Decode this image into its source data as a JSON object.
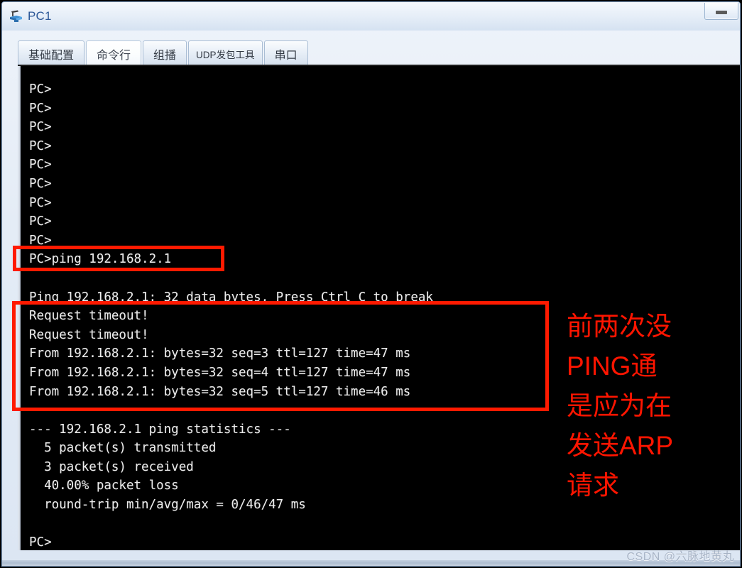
{
  "window": {
    "title": "PC1",
    "icon": "pc-device-icon",
    "minimize_label": "—",
    "accent_color": "#2b5797"
  },
  "tabs": [
    {
      "label": "基础配置",
      "name": "tab-basic-config",
      "active": false,
      "small": false
    },
    {
      "label": "命令行",
      "name": "tab-command-line",
      "active": true,
      "small": false
    },
    {
      "label": "组播",
      "name": "tab-multicast",
      "active": false,
      "small": false
    },
    {
      "label": "UDP发包工具",
      "name": "tab-udp-tool",
      "active": false,
      "small": true
    },
    {
      "label": "串口",
      "name": "tab-serial-port",
      "active": false,
      "small": false
    }
  ],
  "terminal": {
    "prompt": "PC>",
    "lines": [
      "PC>",
      "PC>",
      "PC>",
      "PC>",
      "PC>",
      "PC>",
      "PC>",
      "PC>",
      "PC>",
      "PC>ping 192.168.2.1",
      "",
      "Ping 192.168.2.1: 32 data bytes, Press Ctrl C to break",
      "Request timeout!",
      "Request timeout!",
      "From 192.168.2.1: bytes=32 seq=3 ttl=127 time=47 ms",
      "From 192.168.2.1: bytes=32 seq=4 ttl=127 time=47 ms",
      "From 192.168.2.1: bytes=32 seq=5 ttl=127 time=46 ms",
      "",
      "--- 192.168.2.1 ping statistics ---",
      "  5 packet(s) transmitted",
      "  3 packet(s) received",
      "  40.00% packet loss",
      "  round-trip min/avg/max = 0/46/47 ms",
      "",
      "PC>"
    ],
    "command": "ping 192.168.2.1",
    "target_ip": "192.168.2.1",
    "ping_summary": {
      "data_bytes": 32,
      "transmitted": 5,
      "received": 3,
      "packet_loss": "40.00%",
      "rtt_min_ms": 0,
      "rtt_avg_ms": 46,
      "rtt_max_ms": 47,
      "timeouts": 2,
      "replies": [
        {
          "seq": 3,
          "bytes": 32,
          "ttl": 127,
          "time_ms": 47
        },
        {
          "seq": 4,
          "bytes": 32,
          "ttl": 127,
          "time_ms": 47
        },
        {
          "seq": 5,
          "bytes": 32,
          "ttl": 127,
          "time_ms": 46
        }
      ]
    }
  },
  "annotations": {
    "color": "#ff1500",
    "note_lines": [
      "前两次没",
      "PING通",
      "是应为在",
      "发送ARP",
      "请求"
    ],
    "note_full": "前两次没PING通是应为在发送ARP请求",
    "highlight_boxes": [
      {
        "name": "command-highlight-box",
        "target": "PC>ping 192.168.2.1"
      },
      {
        "name": "ping-output-highlight-box",
        "target": "ping replies block"
      }
    ]
  },
  "watermark": {
    "text": "CSDN @六脉地黄丸"
  }
}
